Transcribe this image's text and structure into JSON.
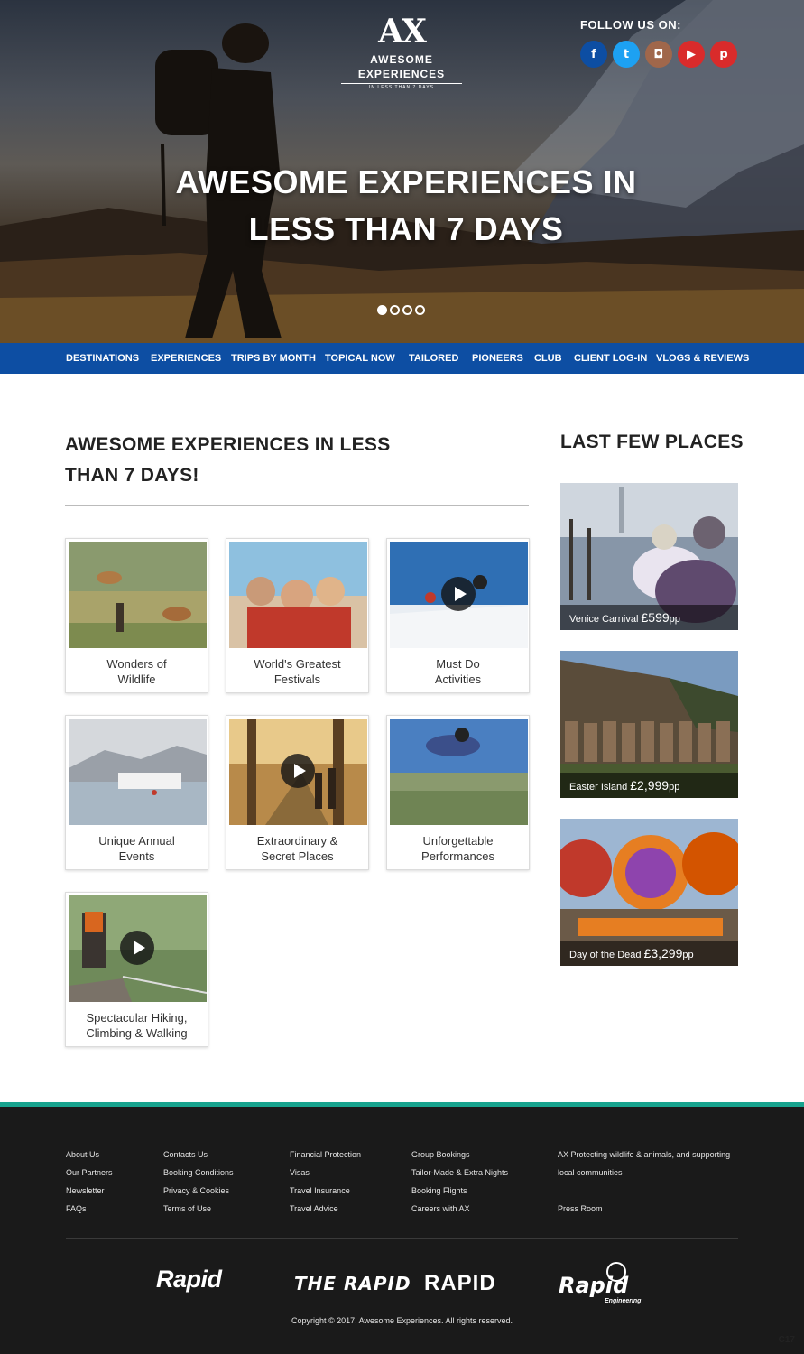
{
  "hero": {
    "logo_mark": "AX",
    "logo_name": "AWESOME EXPERIENCES",
    "logo_tagline": "IN LESS THAN 7 DAYS",
    "follow_label": "FOLLOW US ON:",
    "socials": [
      {
        "icon": "facebook-icon",
        "glyph": "f",
        "color": "#0d4ea3"
      },
      {
        "icon": "twitter-icon",
        "glyph": "t",
        "color": "#1da1f2"
      },
      {
        "icon": "instagram-icon",
        "glyph": "◘",
        "color": "#a0674b"
      },
      {
        "icon": "youtube-icon",
        "glyph": "▶",
        "color": "#d92b2b"
      },
      {
        "icon": "pinterest-icon",
        "glyph": "p",
        "color": "#d92b2b"
      }
    ],
    "title_line1": "AWESOME EXPERIENCES IN",
    "title_line2": "LESS THAN 7 DAYS",
    "slides_total": 4,
    "slide_active": 1
  },
  "nav": {
    "items": [
      "DESTINATIONS",
      "EXPERIENCES",
      "TRIPS BY MONTH",
      "TOPICAL NOW",
      "TAILORED",
      "PIONEERS",
      "CLUB",
      "CLIENT LOG-IN",
      "VLOGS & REVIEWS"
    ],
    "color": "#0d4ea3"
  },
  "main": {
    "title": "AWESOME EXPERIENCES IN LESS THAN 7 DAYS!",
    "cards": [
      {
        "line1": "Wonders of",
        "line2": "Wildlife",
        "video": false
      },
      {
        "line1": "World's Greatest",
        "line2": "Festivals",
        "video": false
      },
      {
        "line1": "Must Do",
        "line2": "Activities",
        "video": true
      },
      {
        "line1": "Unique Annual",
        "line2": "Events",
        "video": false
      },
      {
        "line1": "Extraordinary &",
        "line2": "Secret Places",
        "video": true
      },
      {
        "line1": "Unforgettable",
        "line2": "Performances",
        "video": false
      },
      {
        "line1": "Spectacular Hiking,",
        "line2": "Climbing & Walking",
        "video": true
      }
    ]
  },
  "side": {
    "title": "LAST FEW PLACES",
    "places": [
      {
        "name": "Venice Carnival",
        "price": "£599",
        "unit": "pp"
      },
      {
        "name": "Easter Island",
        "price": "£2,999",
        "unit": "pp"
      },
      {
        "name": "Day of the Dead",
        "price": "£3,299",
        "unit": "pp"
      }
    ]
  },
  "footer": {
    "accent": "#17a38e",
    "col1": [
      "About Us",
      "Our Partners",
      "Newsletter",
      "FAQs"
    ],
    "col2": [
      "Contacts Us",
      "Booking Conditions",
      "Privacy & Cookies",
      "Terms of Use"
    ],
    "col3": [
      "Financial Protection",
      "Visas",
      "Travel Insurance",
      "Travel Advice"
    ],
    "col4": [
      "Group Bookings",
      "Tailor-Made & Extra Nights",
      "Booking Flights",
      "Careers with AX"
    ],
    "col5_line1": "AX Protecting wildlife & animals, and supporting",
    "col5_line2": "local communities",
    "col5_press": "Press Room",
    "brands": [
      "Rapid",
      "THE RAPID",
      "RAPID",
      "Rapid"
    ],
    "brand_sub": "Engineering",
    "copyright": "Copyright © 2017, Awesome Experiences. All rights reserved."
  },
  "corner_label": "C17"
}
